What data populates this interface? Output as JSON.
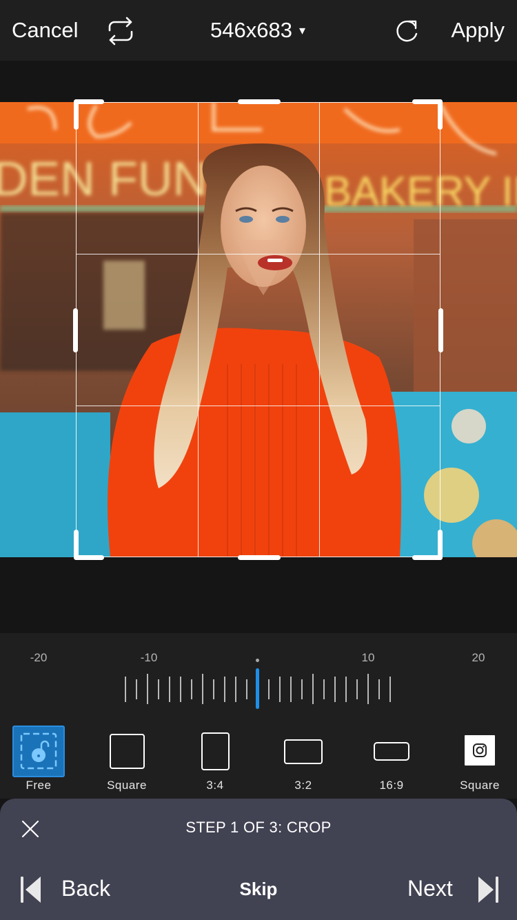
{
  "topbar": {
    "cancel_label": "Cancel",
    "flip_icon": "flip-arrows-icon",
    "dimensions": "546x683",
    "dimensions_caret": "▾",
    "rotate_icon": "rotate-clockwise-icon",
    "apply_label": "Apply"
  },
  "photo": {
    "description": "Woman with long ombre hair in orange knit sweater in front of neon bakery sign",
    "neon_text_left": "DEN FUNG",
    "neon_text_right": "BAKERY INC"
  },
  "crop": {
    "grid": "3x3 rule-of-thirds",
    "aspect_mode": "Free"
  },
  "ruler": {
    "value": 0,
    "min": -23,
    "max": 23,
    "labels": [
      "-20",
      "-10",
      "10",
      "20"
    ],
    "accent_color": "#1e8fe8"
  },
  "aspect_ratios": [
    {
      "label": "Free",
      "icon": "unlocked-free-crop-icon",
      "selected": true
    },
    {
      "label": "Square",
      "icon": "square-icon",
      "selected": false
    },
    {
      "label": "3:4",
      "icon": "portrait-3-4-icon",
      "selected": false
    },
    {
      "label": "3:2",
      "icon": "landscape-3-2-icon",
      "selected": false
    },
    {
      "label": "16:9",
      "icon": "widescreen-16-9-icon",
      "selected": false
    },
    {
      "label": "Square",
      "icon": "instagram-icon",
      "selected": false
    }
  ],
  "tutorial": {
    "title": "STEP 1 OF 3: CROP",
    "back_label": "Back",
    "skip_label": "Skip",
    "next_label": "Next",
    "sheet_color": "#414252"
  }
}
